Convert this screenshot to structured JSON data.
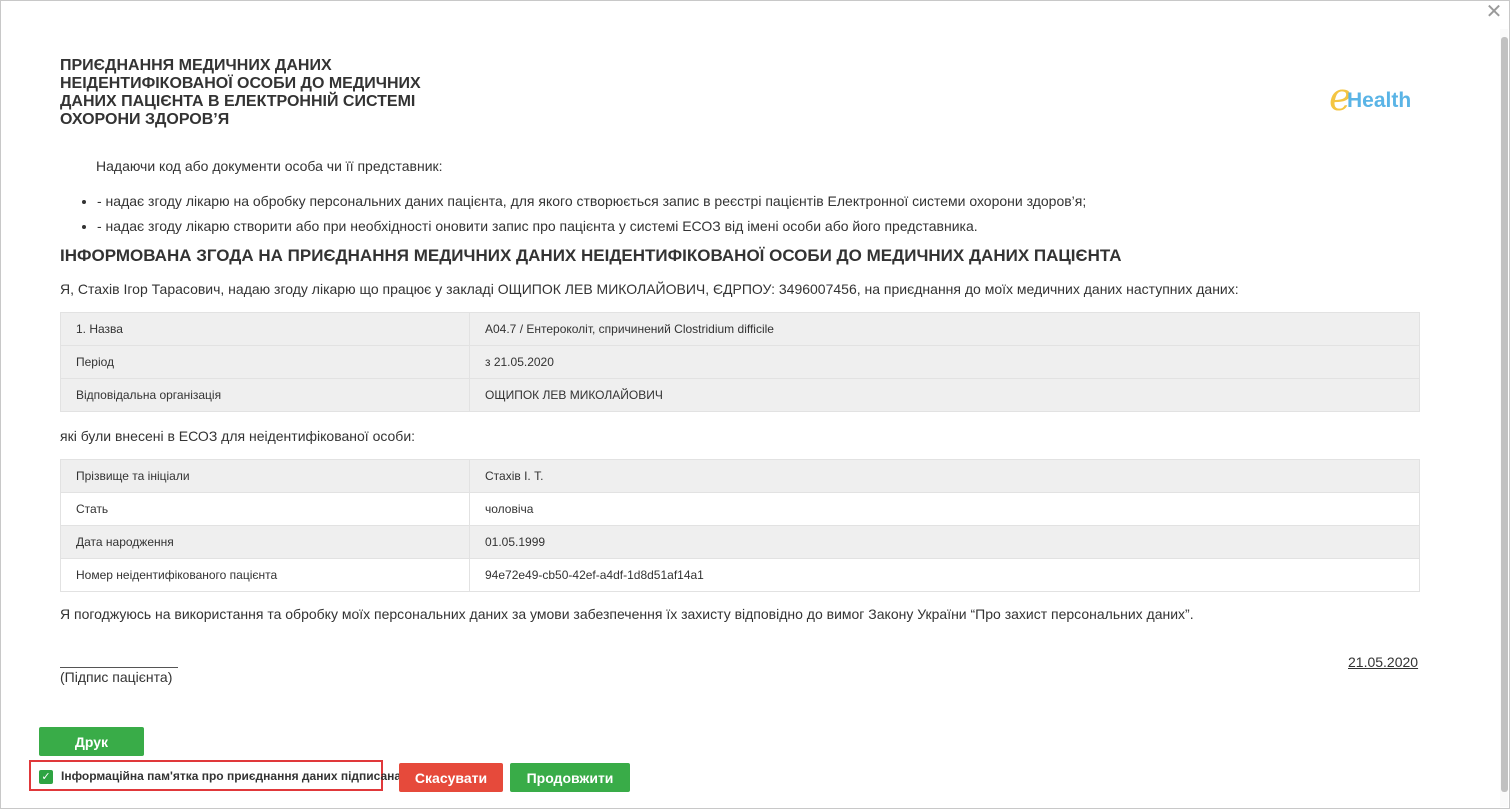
{
  "dialog": {
    "close_symbol": "✕",
    "title": "ПРИЄДНАННЯ МЕДИЧНИХ ДАНИХ НЕІДЕНТИФІКОВАНОЇ ОСОБИ ДО МЕДИЧНИХ ДАНИХ ПАЦІЄНТА В ЕЛЕКТРОННІЙ СИСТЕМІ ОХОРОНИ ЗДОРОВ’Я",
    "logo": {
      "e": "e",
      "health": "Health"
    }
  },
  "intro": "Надаючи код або документи особа чи її представник:",
  "bullets": [
    "- надає згоду лікарю на обробку персональних даних пацієнта, для якого створюється запис в реєстрі пацієнтів Електронної системи охорони здоров’я;",
    "- надає згоду лікарю створити або при необхідності оновити запис про пацієнта у системі ЕСОЗ від імені особи або його представника."
  ],
  "subtitle": "ІНФОРМОВАНА ЗГОДА НА ПРИЄДНАННЯ МЕДИЧНИХ ДАНИХ НЕІДЕНТИФІКОВАНОЇ ОСОБИ ДО МЕДИЧНИХ ДАНИХ ПАЦІЄНТА",
  "consent_text": "Я, Стахів Ігор Тарасович, надаю згоду лікарю що працює у закладі ОЩИПОК ЛЕВ МИКОЛАЙОВИЧ, ЄДРПОУ: 3496007456, на приєднання до моїх медичних даних наступних даних:",
  "medical_table": {
    "rows": [
      {
        "label": "1. Назва",
        "value": "A04.7 / Ентероколіт, спричинений Clostridium difficile"
      },
      {
        "label": "Період",
        "value": "з 21.05.2020"
      },
      {
        "label": "Відповідальна організація",
        "value": "ОЩИПОК ЛЕВ МИКОЛАЙОВИЧ"
      }
    ]
  },
  "entered_text": "які були внесені в ЕСОЗ для неідентифікованої особи:",
  "person_table": {
    "rows": [
      {
        "label": "Прізвище та ініціали",
        "value": "Стахів І. Т."
      },
      {
        "label": "Стать",
        "value": "чоловіча"
      },
      {
        "label": "Дата народження",
        "value": "01.05.1999"
      },
      {
        "label": "Номер неідентифікованого пацієнта",
        "value": "94e72e49-cb50-42ef-a4df-1d8d51af14a1"
      }
    ]
  },
  "agreement_text": "Я погоджуюсь на використання та обробку моїх персональних даних за умови забезпечення їх захисту відповідно до вимог Закону України “Про захист персональних даних”.",
  "signature_label": "(Підпис пацієнта)",
  "date": "21.05.2020",
  "buttons": {
    "print": "Друк",
    "cancel": "Скасувати",
    "continue": "Продовжити"
  },
  "checkbox": {
    "checked": true,
    "check_symbol": "✓",
    "label": "Інформаційна пам'ятка про приєднання даних підписана"
  },
  "colors": {
    "green": "#39ac48",
    "red": "#e64a3b",
    "highlight_border": "#e0383a",
    "logo_yellow": "#f4c542",
    "logo_blue": "#5ab4e6"
  }
}
